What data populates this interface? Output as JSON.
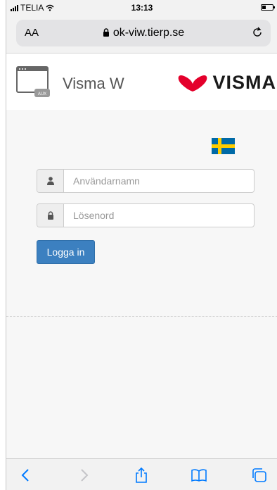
{
  "status_bar": {
    "carrier": "TELIA",
    "time": "13:13"
  },
  "address_bar": {
    "text_size_label": "AA",
    "url": "ok-viw.tierp.se"
  },
  "header": {
    "app_icon_label": "AUX",
    "app_title": "Visma W",
    "brand_name": "VISMA",
    "brand_color": "#e4002b"
  },
  "login_form": {
    "language": "Svenska",
    "username_placeholder": "Användarnamn",
    "username_value": "",
    "password_placeholder": "Lösenord",
    "password_value": "",
    "login_button_label": "Logga in"
  },
  "toolbar": {
    "items": [
      "back",
      "forward",
      "share",
      "bookmarks",
      "tabs"
    ]
  },
  "colors": {
    "primary_button": "#3c80c0",
    "ios_accent": "#007aff"
  }
}
